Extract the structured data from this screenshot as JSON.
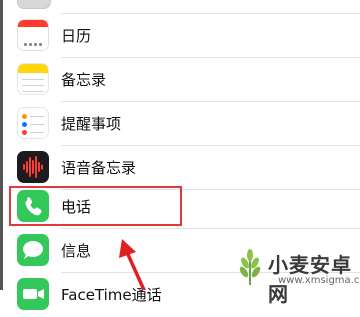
{
  "settings_list": {
    "items": [
      {
        "label": "",
        "icon": "generic-app-icon"
      },
      {
        "label": "日历",
        "icon": "calendar-icon"
      },
      {
        "label": "备忘录",
        "icon": "notes-icon"
      },
      {
        "label": "提醒事项",
        "icon": "reminders-icon"
      },
      {
        "label": "语音备忘录",
        "icon": "voice-memos-icon"
      },
      {
        "label": "电话",
        "icon": "phone-icon"
      },
      {
        "label": "信息",
        "icon": "messages-icon"
      },
      {
        "label": "FaceTime通话",
        "icon": "facetime-icon"
      }
    ]
  },
  "colors": {
    "highlight": "#e23a3a",
    "green": "#34c759",
    "red": "#ff3b30",
    "yellow": "#ffd60a"
  },
  "watermark": {
    "title": "小麦安卓网",
    "url": "www.xmsigma.com"
  }
}
